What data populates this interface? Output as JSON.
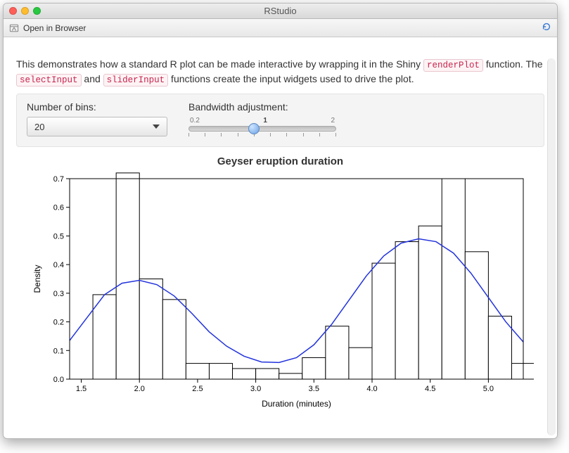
{
  "window": {
    "title": "RStudio"
  },
  "toolbar": {
    "open_label": "Open in Browser"
  },
  "description": {
    "t1": "This demonstrates how a standard R plot can be made interactive by wrapping it in the Shiny ",
    "code1": "renderPlot",
    "t2": " function. The ",
    "code2": "selectInput",
    "t3": " and ",
    "code3": "sliderInput",
    "t4": " functions create the input widgets used to drive the plot."
  },
  "controls": {
    "bins": {
      "label": "Number of bins:",
      "value": "20"
    },
    "bandwidth": {
      "label": "Bandwidth adjustment:",
      "min": "0.2",
      "mid": "1",
      "max": "2",
      "value_frac": 0.444
    }
  },
  "chart_data": {
    "type": "bar",
    "title": "Geyser eruption duration",
    "xlabel": "Duration (minutes)",
    "ylabel": "Density",
    "xlim": [
      1.4,
      5.3
    ],
    "ylim": [
      0.0,
      0.7
    ],
    "xticks": [
      1.5,
      2.0,
      2.5,
      3.0,
      3.5,
      4.0,
      4.5,
      5.0
    ],
    "yticks": [
      0.0,
      0.1,
      0.2,
      0.3,
      0.4,
      0.5,
      0.6,
      0.7
    ],
    "bin_width": 0.2,
    "bins": [
      {
        "x": 1.6,
        "h": 0.295
      },
      {
        "x": 1.8,
        "h": 0.72
      },
      {
        "x": 2.0,
        "h": 0.35
      },
      {
        "x": 2.2,
        "h": 0.278
      },
      {
        "x": 2.4,
        "h": 0.055
      },
      {
        "x": 2.6,
        "h": 0.055
      },
      {
        "x": 2.8,
        "h": 0.037
      },
      {
        "x": 3.0,
        "h": 0.037
      },
      {
        "x": 3.2,
        "h": 0.02
      },
      {
        "x": 3.4,
        "h": 0.075
      },
      {
        "x": 3.6,
        "h": 0.185
      },
      {
        "x": 3.8,
        "h": 0.11
      },
      {
        "x": 4.0,
        "h": 0.405
      },
      {
        "x": 4.2,
        "h": 0.48
      },
      {
        "x": 4.4,
        "h": 0.535
      },
      {
        "x": 4.6,
        "h": 0.7
      },
      {
        "x": 4.8,
        "h": 0.445
      },
      {
        "x": 5.0,
        "h": 0.22
      },
      {
        "x": 5.2,
        "h": 0.055
      }
    ],
    "density_curve": [
      {
        "x": 1.4,
        "y": 0.135
      },
      {
        "x": 1.55,
        "y": 0.215
      },
      {
        "x": 1.7,
        "y": 0.295
      },
      {
        "x": 1.85,
        "y": 0.335
      },
      {
        "x": 2.0,
        "y": 0.345
      },
      {
        "x": 2.15,
        "y": 0.33
      },
      {
        "x": 2.3,
        "y": 0.29
      },
      {
        "x": 2.45,
        "y": 0.23
      },
      {
        "x": 2.6,
        "y": 0.165
      },
      {
        "x": 2.75,
        "y": 0.115
      },
      {
        "x": 2.9,
        "y": 0.08
      },
      {
        "x": 3.05,
        "y": 0.06
      },
      {
        "x": 3.2,
        "y": 0.058
      },
      {
        "x": 3.35,
        "y": 0.075
      },
      {
        "x": 3.5,
        "y": 0.12
      },
      {
        "x": 3.65,
        "y": 0.19
      },
      {
        "x": 3.8,
        "y": 0.275
      },
      {
        "x": 3.95,
        "y": 0.36
      },
      {
        "x": 4.1,
        "y": 0.43
      },
      {
        "x": 4.25,
        "y": 0.475
      },
      {
        "x": 4.4,
        "y": 0.49
      },
      {
        "x": 4.55,
        "y": 0.48
      },
      {
        "x": 4.7,
        "y": 0.44
      },
      {
        "x": 4.85,
        "y": 0.37
      },
      {
        "x": 5.0,
        "y": 0.285
      },
      {
        "x": 5.15,
        "y": 0.2
      },
      {
        "x": 5.3,
        "y": 0.13
      }
    ]
  }
}
